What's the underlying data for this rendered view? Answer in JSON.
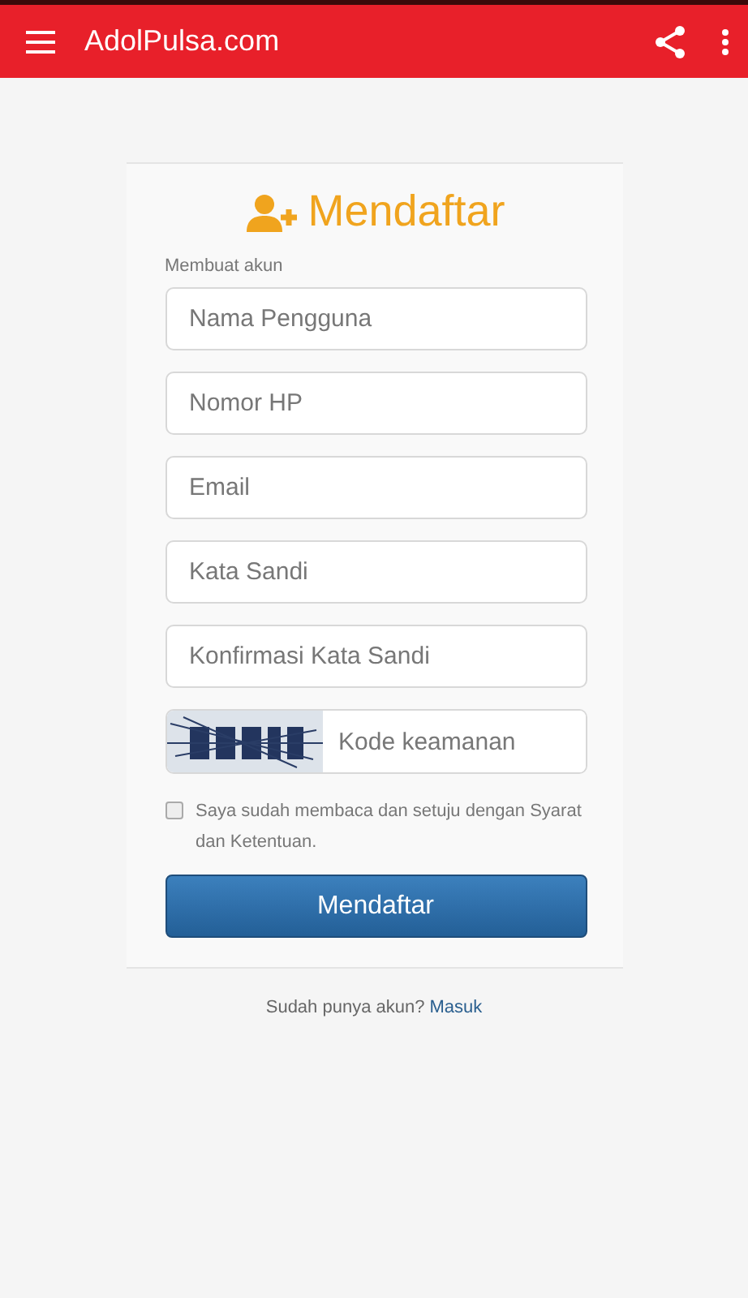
{
  "app_bar": {
    "title": "AdolPulsa.com"
  },
  "form": {
    "title": "Mendaftar",
    "subtitle": "Membuat akun",
    "fields": [
      {
        "placeholder": "Nama Pengguna"
      },
      {
        "placeholder": "Nomor HP"
      },
      {
        "placeholder": "Email"
      },
      {
        "placeholder": "Kata Sandi"
      },
      {
        "placeholder": "Konfirmasi Kata Sandi"
      }
    ],
    "captcha": {
      "kind": "picture",
      "placeholder": "Kode keamanan"
    },
    "agreement": {
      "label": "Saya sudah membaca dan setuju dengan Syarat dan Ketentuan.",
      "checked": false
    },
    "submit": "Mendaftar"
  },
  "footer": {
    "text": "Sudah punya akun?",
    "link": "Masuk"
  }
}
